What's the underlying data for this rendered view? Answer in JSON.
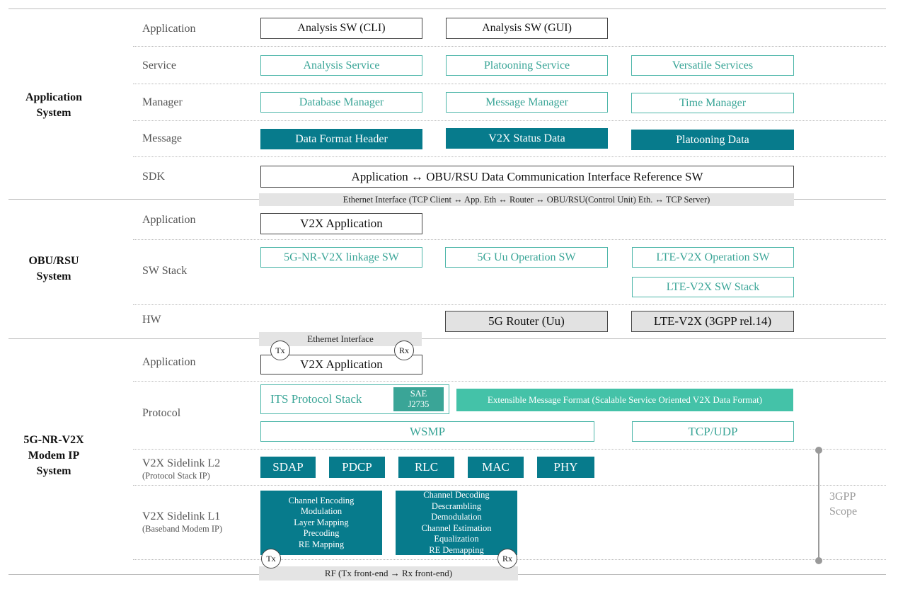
{
  "systems": {
    "app_system": "Application\nSystem",
    "obu_system": "OBU/RSU\nSystem",
    "modem_system": "5G-NR-V2X\nModem IP\nSystem"
  },
  "layers": {
    "app_application": "Application",
    "app_service": "Service",
    "app_manager": "Manager",
    "app_message": "Message",
    "app_sdk": "SDK",
    "obu_application": "Application",
    "obu_swstack": "SW Stack",
    "obu_hw": "HW",
    "modem_application": "Application",
    "modem_protocol": "Protocol",
    "modem_l2": "V2X Sidelink L2",
    "modem_l2_sub": "(Protocol Stack IP)",
    "modem_l1": "V2X Sidelink L1",
    "modem_l1_sub": "(Baseband Modem IP)"
  },
  "boxes": {
    "analysis_cli": "Analysis SW (CLI)",
    "analysis_gui": "Analysis SW (GUI)",
    "analysis_service": "Analysis Service",
    "platooning_service": "Platooning Service",
    "versatile_services": "Versatile Services",
    "database_manager": "Database Manager",
    "message_manager": "Message Manager",
    "time_manager": "Time Manager",
    "data_format_header": "Data Format Header",
    "v2x_status_data": "V2X Status Data",
    "platooning_data": "Platooning Data",
    "sdk_interface": "Application ↔ OBU/RSU Data Communication Interface Reference SW",
    "obu_v2x_application": "V2X Application",
    "nr_v2x_linkage": "5G-NR-V2X linkage SW",
    "uu_operation": "5G Uu Operation SW",
    "lte_v2x_operation": "LTE-V2X Operation SW",
    "lte_v2x_stack": "LTE-V2X SW Stack",
    "router_uu": "5G Router (Uu)",
    "lte_v2x_hw": "LTE-V2X (3GPP rel.14)",
    "modem_v2x_application": "V2X Application",
    "its_protocol_stack": "ITS Protocol Stack",
    "sae_j2735": "SAE\nJ2735",
    "extensible_format": "Extensible Message Format (Scalable Service Oriented V2X Data Format)",
    "wsmp": "WSMP",
    "tcp_udp": "TCP/UDP",
    "sdap": "SDAP",
    "pdcp": "PDCP",
    "rlc": "RLC",
    "mac": "MAC",
    "phy": "PHY",
    "tx_chain": "Channel Encoding\nModulation\nLayer Mapping\nPrecoding\nRE Mapping",
    "rx_chain": "Channel Decoding\nDescrambling\nDemodulation\nChannel Estimation\nEqualization\nRE Demapping"
  },
  "bars": {
    "ethernet_tcp": "Ethernet Interface (TCP Client ↔ App. Eth ↔ Router ↔ OBU/RSU(Control Unit) Eth. ↔ TCP Server)",
    "ethernet_interface": "Ethernet Interface",
    "rf": "RF (Tx front-end → Rx front-end)"
  },
  "markers": {
    "tx": "Tx",
    "rx": "Rx"
  },
  "scope_label": "3GPP\nScope",
  "colors": {
    "teal": "#077b8c",
    "mint": "#44c2a8",
    "outline_teal": "#4db6a9",
    "gray_fill": "#e2e2e2"
  }
}
